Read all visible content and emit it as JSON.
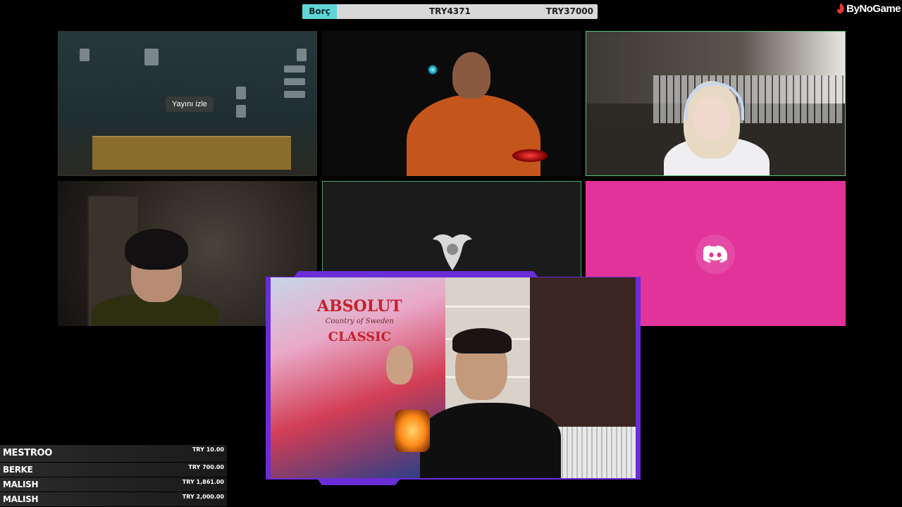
{
  "debt_bar": {
    "label": "Borç",
    "current": "TRY4371",
    "target": "TRY37000",
    "accent": "#5ed6d6"
  },
  "logo": {
    "text": "ByNoGame",
    "icon": "flame-icon",
    "accent": "#e53a2e"
  },
  "tiles": {
    "game": {
      "watch_button": "Yayını izle"
    },
    "discord": {
      "icon": "discord-icon",
      "background": "#e2339a"
    },
    "center_logo": {
      "icon": "winged-emblem-icon"
    }
  },
  "main_cam": {
    "poster_line1": "ABSOLUT",
    "poster_line2": "Country of Sweden",
    "poster_line3": "CLASSIC",
    "frame_color": "#6a2dd8"
  },
  "donations": [
    {
      "name": "MESTROO",
      "amount": "TRY 10.00"
    },
    {
      "name": "BERKE",
      "amount": "TRY 700.00"
    },
    {
      "name": "MALISH",
      "amount": "TRY 1,861.00"
    },
    {
      "name": "MALISH",
      "amount": "TRY 2,000.00"
    }
  ]
}
